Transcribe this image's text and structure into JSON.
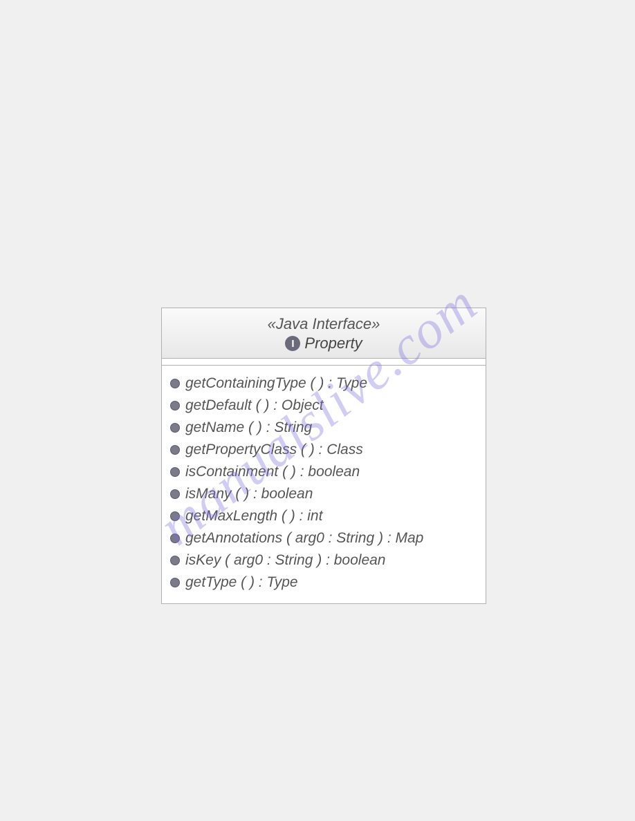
{
  "watermark": "manualslive.com",
  "uml": {
    "stereotype": "«Java Interface»",
    "badge_letter": "I",
    "name": "Property",
    "methods": [
      "getContainingType ( ) : Type",
      "getDefault ( ) : Object",
      "getName ( ) : String",
      "getPropertyClass ( ) : Class",
      "isContainment ( ) : boolean",
      "isMany ( ) : boolean",
      "getMaxLength ( ) : int",
      "getAnnotations ( arg0 : String ) : Map",
      "isKey ( arg0 : String ) : boolean",
      "getType ( ) : Type"
    ]
  }
}
